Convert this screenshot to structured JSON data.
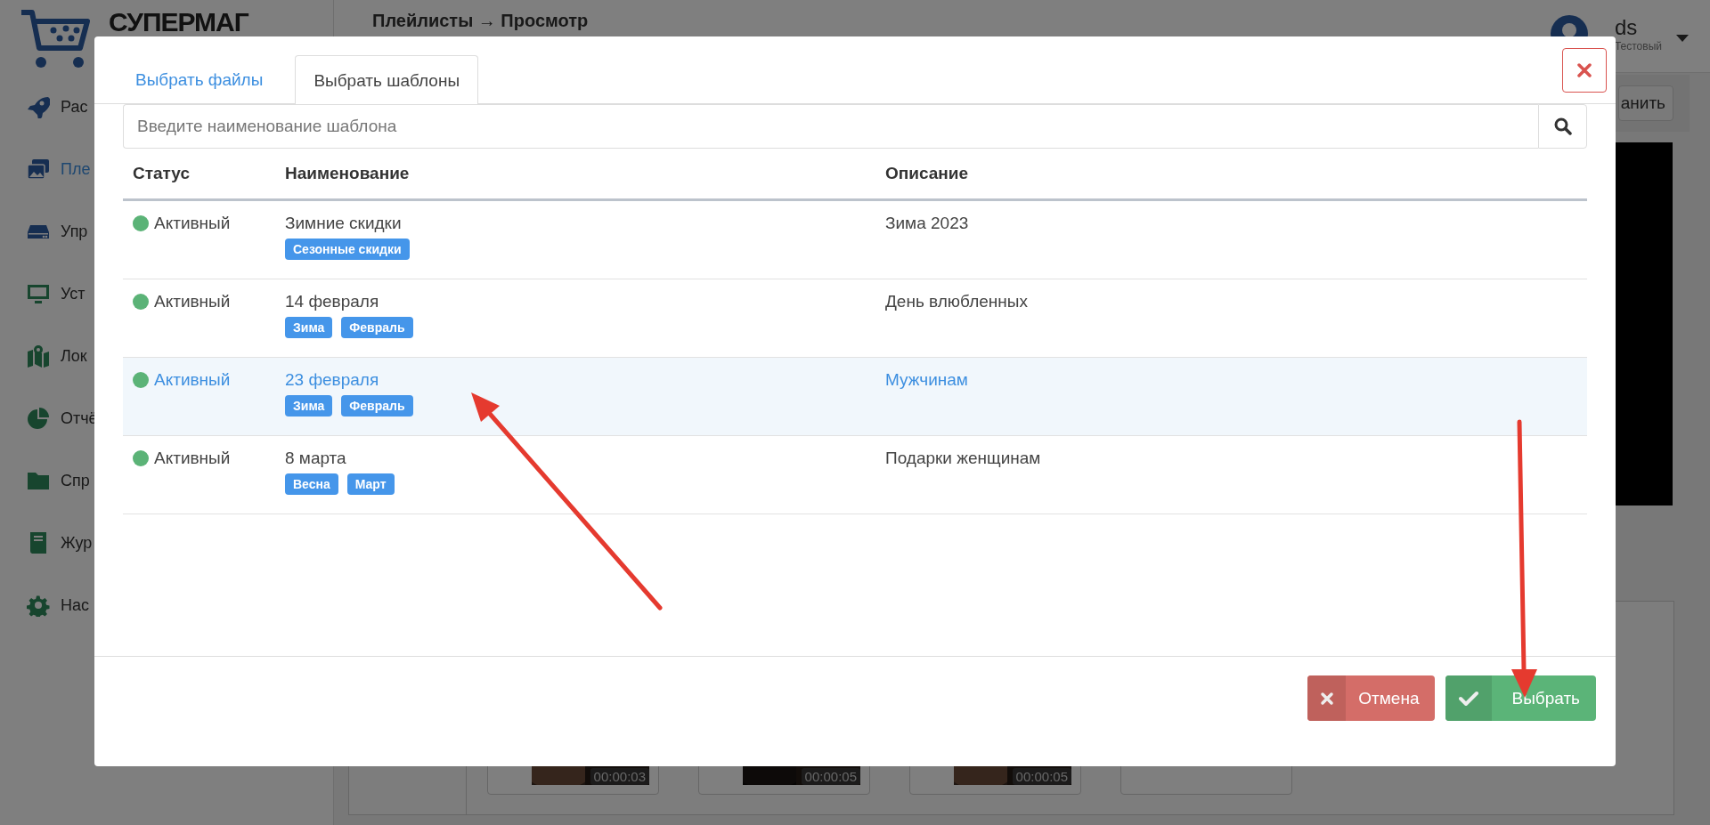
{
  "sidebar": {
    "logo": "СУПЕРМАГ",
    "items": [
      {
        "label": "Рас",
        "selected": false
      },
      {
        "label": "Пле",
        "selected": true
      },
      {
        "label": "Упр",
        "selected": false
      },
      {
        "label": "Уст",
        "selected": false
      },
      {
        "label": "Лок",
        "selected": false
      },
      {
        "label": "Отчё",
        "selected": false
      },
      {
        "label": "Спр",
        "selected": false
      },
      {
        "label": "Жур",
        "selected": false
      },
      {
        "label": "Нас",
        "selected": false
      }
    ]
  },
  "header": {
    "breadcrumb": "Плейлисты → Просмотр",
    "user": {
      "name": "ds",
      "role": "Тестовый"
    }
  },
  "toolbar": {
    "save_button": "анить"
  },
  "clips": [
    {
      "kind": "clip",
      "duration": "00:00:03"
    },
    {
      "kind": "clip",
      "duration": "00:00:05"
    },
    {
      "kind": "clip",
      "duration": "00:00:05"
    },
    {
      "kind": "empty"
    }
  ],
  "dialog": {
    "tabs": [
      {
        "label": "Выбрать файлы",
        "selected": false
      },
      {
        "label": "Выбрать шаблоны",
        "selected": true
      }
    ],
    "search": {
      "placeholder": "Введите наименование шаблона"
    },
    "table": {
      "columns": [
        "Статус",
        "Наименование",
        "Описание"
      ],
      "rows": [
        {
          "status": "Активный",
          "name": "Зимние скидки",
          "tags": [
            "Сезонные скидки"
          ],
          "description": "Зима 2023",
          "selected": false
        },
        {
          "status": "Активный",
          "name": "14 февраля",
          "tags": [
            "Зима",
            "Февраль"
          ],
          "description": "День влюбленных",
          "selected": false
        },
        {
          "status": "Активный",
          "name": "23 февраля",
          "tags": [
            "Зима",
            "Февраль"
          ],
          "description": "Мужчинам",
          "selected": true
        },
        {
          "status": "Активный",
          "name": "8 марта",
          "tags": [
            "Весна",
            "Март"
          ],
          "description": "Подарки женщинам",
          "selected": false
        }
      ]
    },
    "buttons": [
      {
        "label": "Отмена",
        "kind": "cancel"
      },
      {
        "label": "Выбрать",
        "kind": "confirm"
      }
    ]
  }
}
